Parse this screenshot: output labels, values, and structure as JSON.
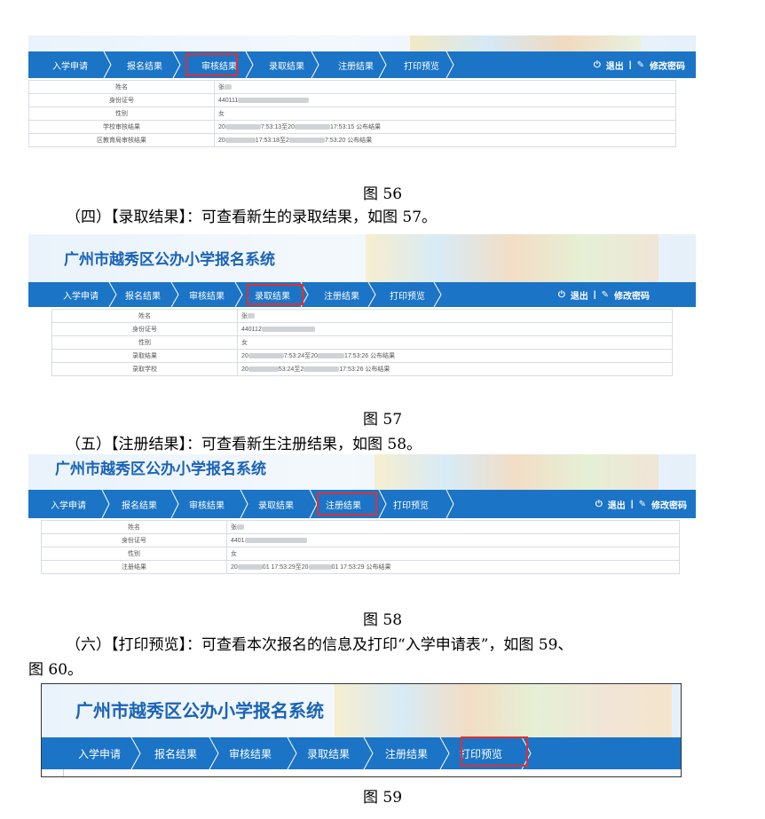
{
  "system_title": "广州市越秀区公办小学报名系统",
  "nav_labels": [
    "入学申请",
    "报名结果",
    "审核结果",
    "录取结果",
    "注册结果",
    "打印预览"
  ],
  "nav_right": {
    "logout": "退出",
    "separator": "|",
    "change_password": "修改密码"
  },
  "colors": {
    "nav_blue": "#1b74c6",
    "title_blue": "#1a63b8",
    "highlight_red": "#e03030"
  },
  "figures": {
    "fig56": {
      "caption": "图 56",
      "highlight": "审核结果",
      "rows": [
        {
          "label": "姓名",
          "value": "张"
        },
        {
          "label": "身份证号",
          "value": "440111"
        },
        {
          "label": "性别",
          "value": "女"
        },
        {
          "label": "学校审核结果",
          "value_a": "20",
          "value_b": "7:53:13至20",
          "value_c": "17:53:15 公布结果"
        },
        {
          "label": "区教育局审核结果",
          "value_a": "20",
          "value_b": "17:53:18至2",
          "value_c": "7:53:20 公布结果"
        }
      ]
    },
    "fig57": {
      "caption": "图 57",
      "highlight": "录取结果",
      "rows": [
        {
          "label": "姓名",
          "value": "张"
        },
        {
          "label": "身份证号",
          "value": "440112"
        },
        {
          "label": "性别",
          "value": "女"
        },
        {
          "label": "录取结果",
          "value_a": "20",
          "value_b": "7:53:24至20",
          "value_c": "17:53:26 公布结果"
        },
        {
          "label": "录取学校",
          "value_a": "20",
          "value_b": "53:24至2",
          "value_c": "17:53:26 公布结果"
        }
      ]
    },
    "fig58": {
      "caption": "图 58",
      "highlight": "注册结果",
      "rows": [
        {
          "label": "姓名",
          "value": "张"
        },
        {
          "label": "身份证号",
          "value": "4401"
        },
        {
          "label": "性别",
          "value": "女"
        },
        {
          "label": "注册结果",
          "value_a": "20",
          "value_b": "01 17:53:29至20",
          "value_c": "01 17:53:29 公布结果"
        }
      ]
    },
    "fig59": {
      "caption": "图 59",
      "highlight": "打印预览"
    }
  },
  "paragraphs": {
    "p4": "（四）【录取结果】：可查看新生的录取结果，如图 57。",
    "p5": "（五）【注册结果】：可查看新生注册结果，如图 58。",
    "p6_line1": "（六）【打印预览】：可查看本次报名的信息及打印“入学申请表”，如图 59、",
    "p6_line2": "图 60。"
  }
}
